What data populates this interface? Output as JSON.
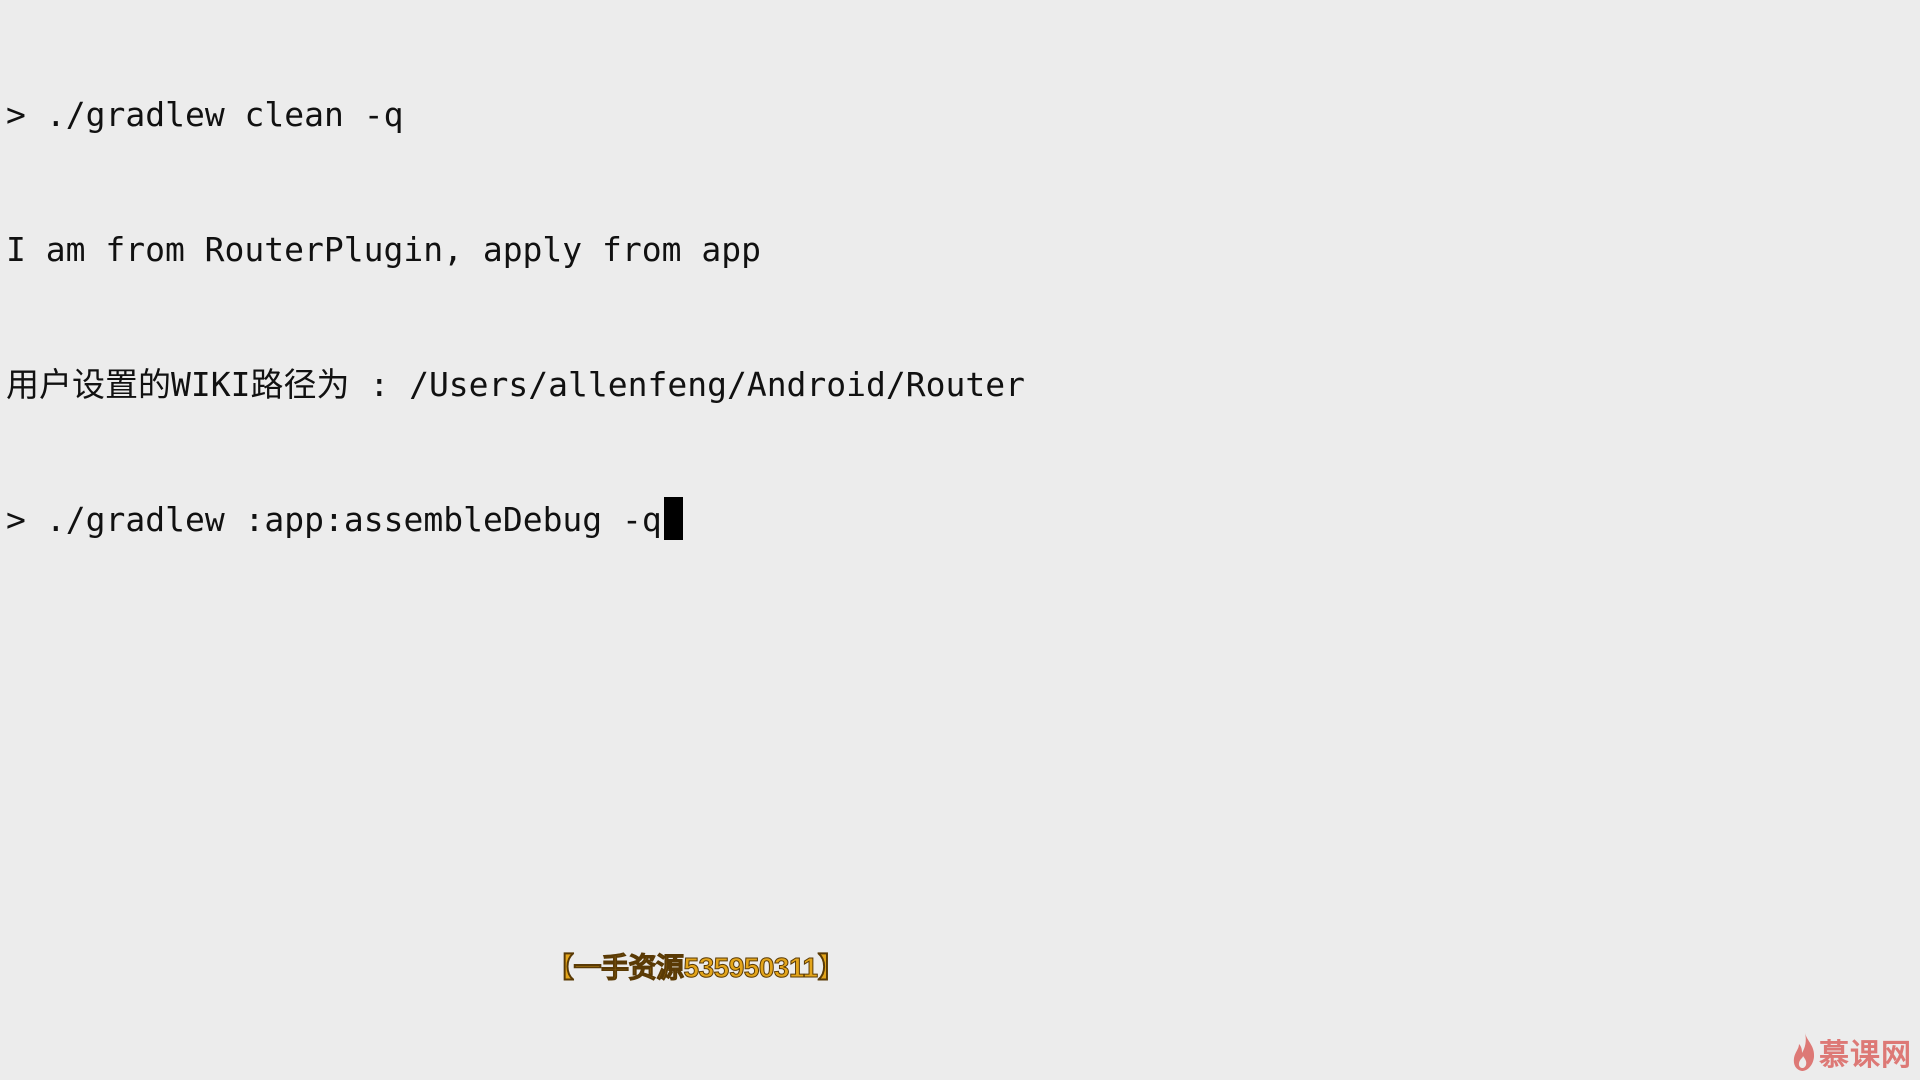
{
  "terminal": {
    "lines": [
      {
        "prompt": ">",
        "text": "./gradlew clean -q"
      },
      {
        "prompt": "",
        "text": "I am from RouterPlugin, apply from app"
      },
      {
        "prompt": "",
        "text": "用户设置的WIKI路径为 : /Users/allenfeng/Android/Router"
      },
      {
        "prompt": ">",
        "text": "./gradlew :app:assembleDebug -q"
      }
    ]
  },
  "watermark": {
    "text": "【一手资源535950311】",
    "color": "#e3a51b"
  },
  "logo": {
    "text": "慕课网",
    "icon": "flame-icon",
    "color": "#d9534f"
  }
}
